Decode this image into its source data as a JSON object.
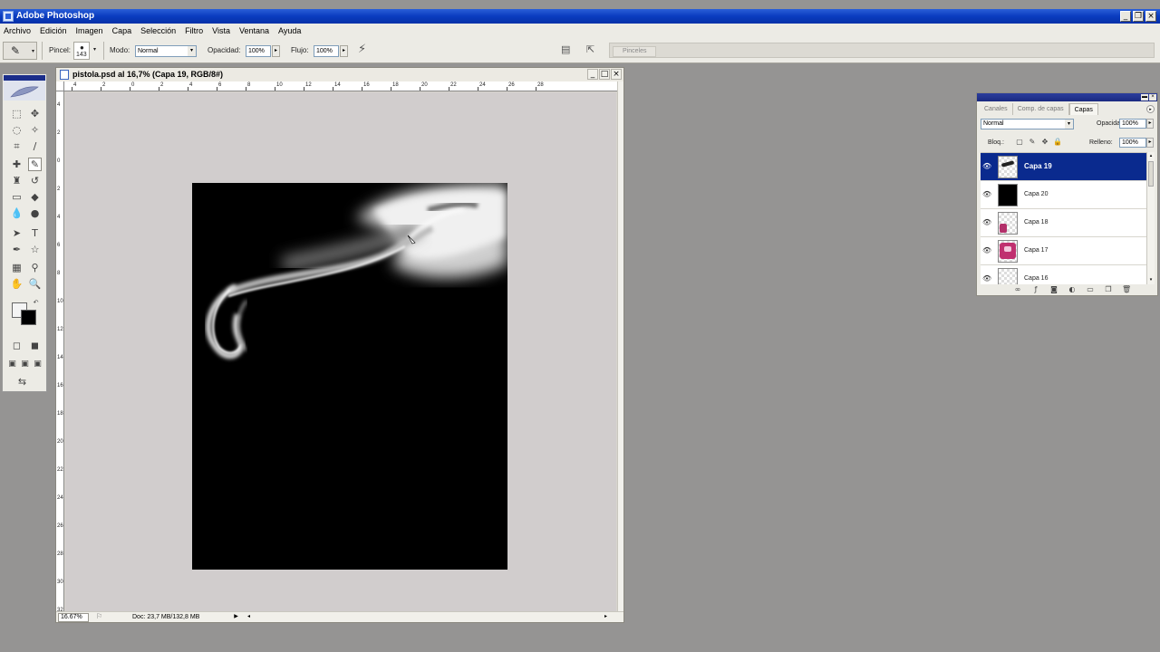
{
  "window": {
    "title": "Adobe Photoshop"
  },
  "menu": [
    "Archivo",
    "Edición",
    "Imagen",
    "Capa",
    "Selección",
    "Filtro",
    "Vista",
    "Ventana",
    "Ayuda"
  ],
  "options": {
    "brush_label": "Pincel:",
    "brush_size": "143",
    "mode_label": "Modo:",
    "mode_value": "Normal",
    "opacity_label": "Opacidad:",
    "opacity_value": "100%",
    "flow_label": "Flujo:",
    "flow_value": "100%",
    "palette_well_tab": "Pinceles"
  },
  "document": {
    "title": "pistola.psd al 16,7% (Capa 19, RGB/8#)",
    "zoom": "16.67%",
    "doc_info": "Doc: 23,7 MB/132,8 MB",
    "ruler_top": [
      "4",
      "2",
      "0",
      "2",
      "4",
      "6",
      "8",
      "10",
      "12",
      "14",
      "16",
      "18",
      "20",
      "22",
      "24",
      "26",
      "28"
    ],
    "ruler_left": [
      "4",
      "2",
      "0",
      "2",
      "4",
      "6",
      "8",
      "10",
      "12",
      "14",
      "16",
      "18",
      "20",
      "22",
      "24",
      "26",
      "28",
      "30",
      "32",
      "34"
    ]
  },
  "layers_panel": {
    "tabs": [
      "Canales",
      "Comp. de capas",
      "Capas"
    ],
    "active_tab": "Capas",
    "blend_mode": "Normal",
    "opacity_label": "Opacidad:",
    "opacity_value": "100%",
    "lock_label": "Bloq.:",
    "fill_label": "Relleno:",
    "fill_value": "100%",
    "layers": [
      {
        "name": "Capa 19",
        "selected": true,
        "thumb": "smoke"
      },
      {
        "name": "Capa 20",
        "selected": false,
        "thumb": "black"
      },
      {
        "name": "Capa 18",
        "selected": false,
        "thumb": "pink-small"
      },
      {
        "name": "Capa 17",
        "selected": false,
        "thumb": "pink"
      },
      {
        "name": "Capa 16",
        "selected": false,
        "thumb": "empty"
      }
    ]
  },
  "colors": {
    "foreground": "#f4f4f4",
    "background": "#000000",
    "selection": "#0a2a8e"
  }
}
